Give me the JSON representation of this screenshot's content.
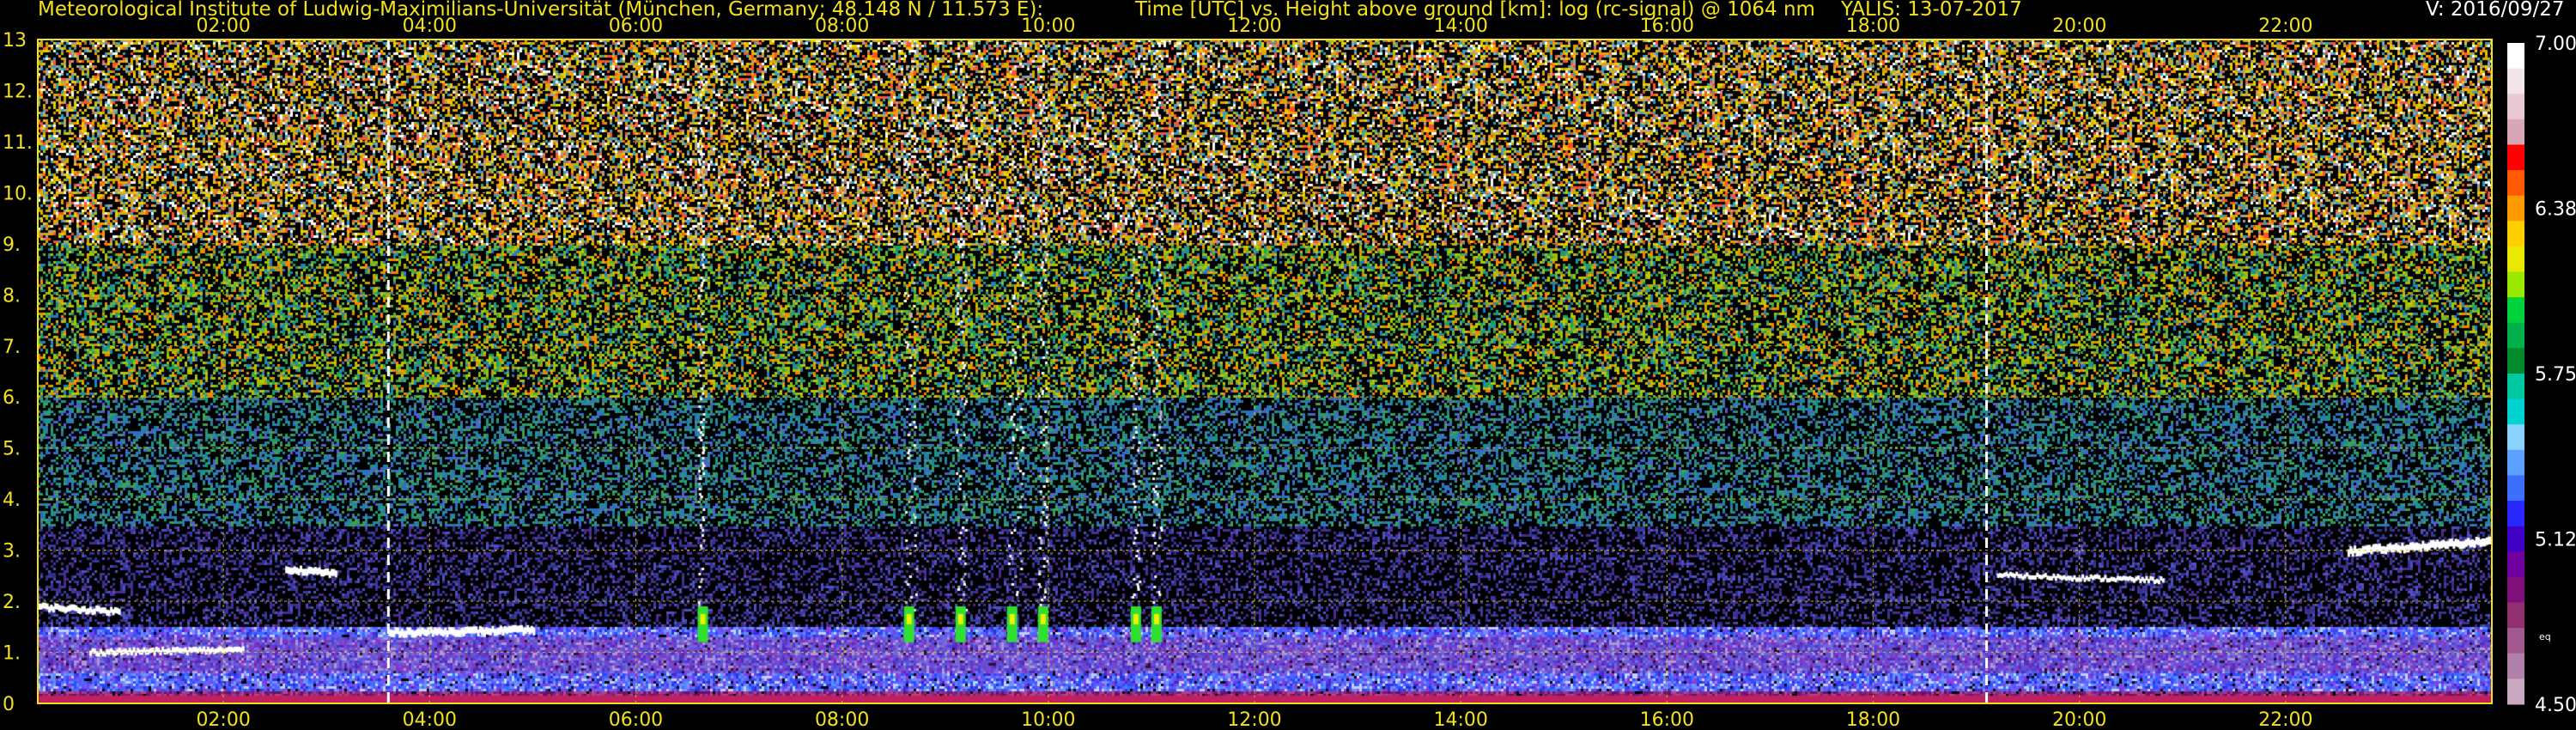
{
  "header": {
    "institute": "Meteorological Institute of Ludwig-Maximilians-Universität (München, Germany; 48.148 N / 11.573 E):",
    "axes_desc": "Time [UTC] vs. Height above ground [km]: log (rc-signal) @ 1064 nm",
    "instrument_date": "YALIS: 13-07-2017",
    "version": "V: 2016/09/27"
  },
  "chart_data": {
    "type": "heatmap",
    "title": "Time [UTC] vs. Height above ground [km]: log (rc-signal) @ 1064 nm",
    "x_ticks": [
      "02:00",
      "04:00",
      "06:00",
      "08:00",
      "10:00",
      "12:00",
      "14:00",
      "16:00",
      "18:00",
      "20:00",
      "22:00"
    ],
    "x_range_hours": [
      0.2,
      24.0
    ],
    "y_ticks": [
      "0",
      "1.",
      "2.",
      "3.",
      "4.",
      "5.",
      "6.",
      "7.",
      "8.",
      "9.",
      "10.",
      "11.",
      "12.",
      "13"
    ],
    "y_range_km": [
      0,
      13
    ],
    "grid": true,
    "colorbar": {
      "labels": [
        "7.00",
        "6.38",
        "5.75",
        "5.12",
        "4.50"
      ],
      "unit_label": "eq",
      "range": [
        4.5,
        7.0
      ],
      "colors": [
        "#ffffff",
        "#f1e5e9",
        "#e9c9d1",
        "#d8a7b5",
        "#ff0000",
        "#ff5a00",
        "#ff9a00",
        "#ffcf00",
        "#e8e800",
        "#9be800",
        "#00d23c",
        "#00b04a",
        "#008a2a",
        "#00c8a0",
        "#00d2d2",
        "#8cd2ff",
        "#5aa0ff",
        "#3c6eff",
        "#2828ff",
        "#4000c8",
        "#7000a0",
        "#80107a",
        "#903070",
        "#a05a90",
        "#b080a8",
        "#c8a8c0"
      ]
    },
    "layers": [
      {
        "name": "boundary layer aerosol",
        "x_hours": [
          0.2,
          24.0
        ],
        "top_km": [
          1.3,
          1.2
        ]
      },
      {
        "name": "cloud base night",
        "x_hours": [
          0.2,
          1.0
        ],
        "height_km": [
          1.9,
          1.8
        ]
      },
      {
        "name": "cloud base evening",
        "x_hours": [
          19.2,
          24.0
        ],
        "height_km": [
          2.5,
          3.2
        ]
      }
    ],
    "dashed_markers_hours": [
      3.6,
      19.1
    ]
  }
}
